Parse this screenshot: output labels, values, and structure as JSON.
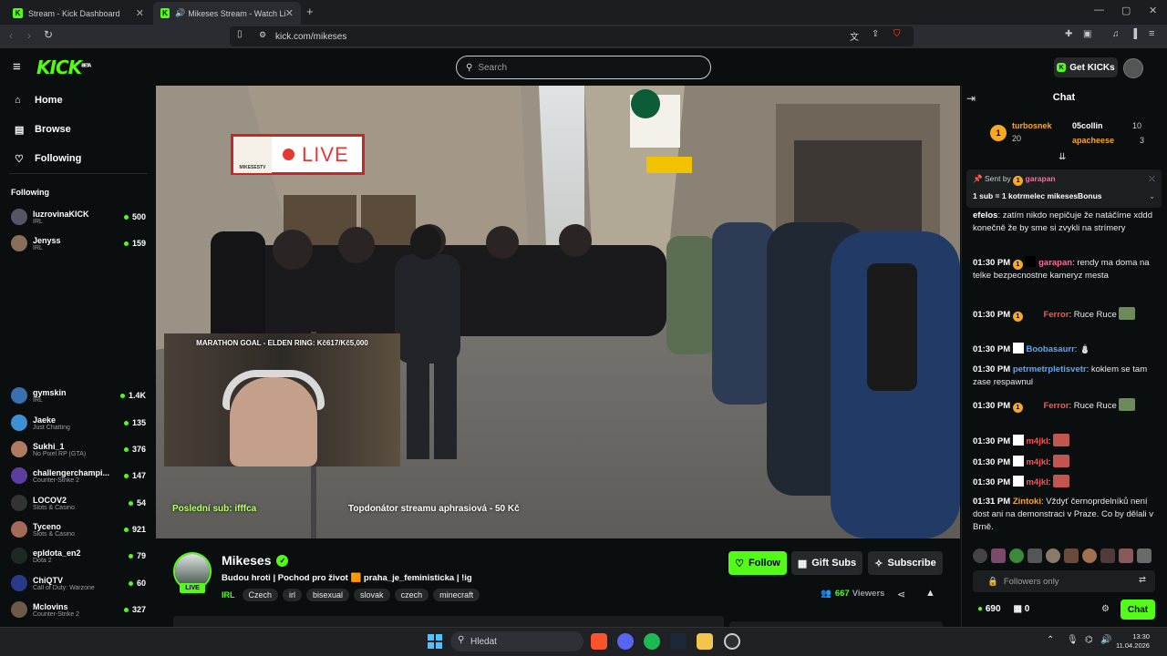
{
  "browser": {
    "tabs": [
      {
        "title": "Stream - Kick Dashboard"
      },
      {
        "title": "Mikeses Stream - Watch Live"
      }
    ],
    "url": "kick.com/mikeses"
  },
  "header": {
    "logo": "KICK",
    "logo_beta": "BETA",
    "search_placeholder": "Search",
    "get_kicks": "Get KICKs"
  },
  "sidebar": {
    "nav": [
      {
        "label": "Home",
        "icon": "home-icon"
      },
      {
        "label": "Browse",
        "icon": "browse-icon"
      },
      {
        "label": "Following",
        "icon": "heart-icon"
      }
    ],
    "following_heading": "Following",
    "channels": [
      {
        "name": "luzrovinaKICK",
        "category": "IRL",
        "viewers": "500"
      },
      {
        "name": "Jenyss",
        "category": "IRL",
        "viewers": "159"
      },
      {
        "name": "gymskin",
        "category": "IRL",
        "viewers": "1.4K"
      },
      {
        "name": "Jaeke",
        "category": "Just Chatting",
        "viewers": "135"
      },
      {
        "name": "Sukhi_1",
        "category": "No Pixel RP (GTA)",
        "viewers": "376"
      },
      {
        "name": "challengerchampi...",
        "category": "Counter-Strike 2",
        "viewers": "147"
      },
      {
        "name": "LOCOV2",
        "category": "Slots & Casino",
        "viewers": "54"
      },
      {
        "name": "Tyceno",
        "category": "Slots & Casino",
        "viewers": "921"
      },
      {
        "name": "epldota_en2",
        "category": "Dota 2",
        "viewers": "79"
      },
      {
        "name": "ChiQTV",
        "category": "Call of Duty: Warzone",
        "viewers": "60"
      },
      {
        "name": "Mclovins",
        "category": "Counter-Strike 2",
        "viewers": "327"
      }
    ]
  },
  "video": {
    "marathon_goal": "MARATHON GOAL - ELDEN RING: Kč617/Kč5,000",
    "live_badge_brand": "MIKESESTV",
    "live_badge_text": "LIVE",
    "last_sub": "Poslední sub: ifffca",
    "top_donator": "Topdonátor streamu aphrasiová - 50 Kč"
  },
  "stream": {
    "streamer": "Mikeses",
    "live_label": "LIVE",
    "title": "Budou hroti | Pochod pro život 🟧 praha_je_feministicka | !ig",
    "category": "IRL",
    "tags": [
      "Czech",
      "irl",
      "bisexual",
      "slovak",
      "czech",
      "minecraft"
    ],
    "follow_label": "Follow",
    "gift_subs_label": "Gift Subs",
    "subscribe_label": "Subscribe",
    "viewers": "667",
    "viewers_label": "Viewers"
  },
  "chat": {
    "title": "Chat",
    "leaders": [
      {
        "name": "turbosnek",
        "count": "20"
      },
      {
        "name": "05collin",
        "count": "10"
      },
      {
        "name": "apacheese",
        "count": "3"
      }
    ],
    "pinned_sent_by_label": "Sent by",
    "pinned_user": "garapan",
    "pinned_text": "1 sub = 1 kotrmelec mikesesBonus",
    "messages": [
      {
        "time": "",
        "user": "efelos",
        "color": "#ffffff",
        "text": "zatím nikdo nepičuje že natáčíme xddd konečně že by sme si zvykli na strímery"
      },
      {
        "time": "01:30 PM",
        "user": "garapan",
        "color": "#ff6b9a",
        "text": "rendy ma doma na telke bezpecnostne kameryz mesta"
      },
      {
        "time": "01:30 PM",
        "user": "Ferror",
        "color": "#ff5252",
        "text": "Ruce Ruce"
      },
      {
        "time": "01:30 PM",
        "user": "Boobasaurr",
        "color": "#5aa9ff",
        "text": ""
      },
      {
        "time": "01:30 PM",
        "user": "petrmetrpletisvetr",
        "color": "#5aa9ff",
        "text": "koklem se tam zase respawnul"
      },
      {
        "time": "01:30 PM",
        "user": "Ferror",
        "color": "#ff5252",
        "text": "Ruce Ruce"
      },
      {
        "time": "01:30 PM",
        "user": "m4jkl",
        "color": "#ff5252",
        "text": ""
      },
      {
        "time": "01:30 PM",
        "user": "m4jkl",
        "color": "#ff5252",
        "text": ""
      },
      {
        "time": "01:30 PM",
        "user": "m4jkl",
        "color": "#ff5252",
        "text": ""
      },
      {
        "time": "01:31 PM",
        "user": "Zintoki",
        "color": "#f9a825",
        "text": "Vždyť černoprdelníků není dost ani na demonstraci v Praze. Co by dělali v Brně."
      }
    ],
    "input_placeholder": "Followers only",
    "kicks_count": "690",
    "second_count": "0",
    "send_label": "Chat"
  },
  "taskbar": {
    "search_label": "Hledat",
    "time": "13:30",
    "date": "11.04.2026"
  }
}
